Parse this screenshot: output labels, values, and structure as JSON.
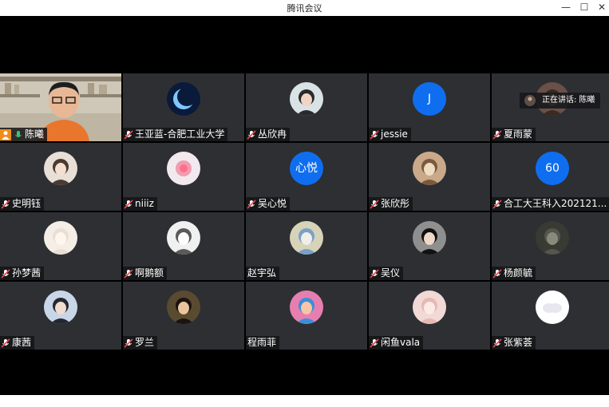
{
  "window": {
    "title": "腾讯会议",
    "minimize": "—",
    "maximize": "☐",
    "close": "✕"
  },
  "speaking_badge": {
    "text": "正在讲话: 陈曦"
  },
  "self_tile": {
    "name": "陈曦"
  },
  "participants": [
    {
      "name": "王亚蓝-合肥工业大学",
      "avatar_text": ""
    },
    {
      "name": "丛欣冉",
      "avatar_text": ""
    },
    {
      "name": "jessie",
      "avatar_text": "J"
    },
    {
      "name": "夏雨蒙",
      "avatar_text": ""
    },
    {
      "name": "史明钰",
      "avatar_text": ""
    },
    {
      "name": "niiiz",
      "avatar_text": ""
    },
    {
      "name": "吴心悦",
      "avatar_text": "心悦"
    },
    {
      "name": "张欣彤",
      "avatar_text": ""
    },
    {
      "name": "合工大王科入202121...",
      "avatar_text": "60"
    },
    {
      "name": "孙梦茜",
      "avatar_text": ""
    },
    {
      "name": "啊鹅额",
      "avatar_text": ""
    },
    {
      "name": "赵宇弘",
      "avatar_text": ""
    },
    {
      "name": "吴仪",
      "avatar_text": ""
    },
    {
      "name": "杨颜毓",
      "avatar_text": ""
    },
    {
      "name": "康茜",
      "avatar_text": ""
    },
    {
      "name": "罗兰",
      "avatar_text": ""
    },
    {
      "name": "程雨菲",
      "avatar_text": ""
    },
    {
      "name": "闲鱼vala",
      "avatar_text": ""
    },
    {
      "name": "张紫荟",
      "avatar_text": ""
    }
  ]
}
